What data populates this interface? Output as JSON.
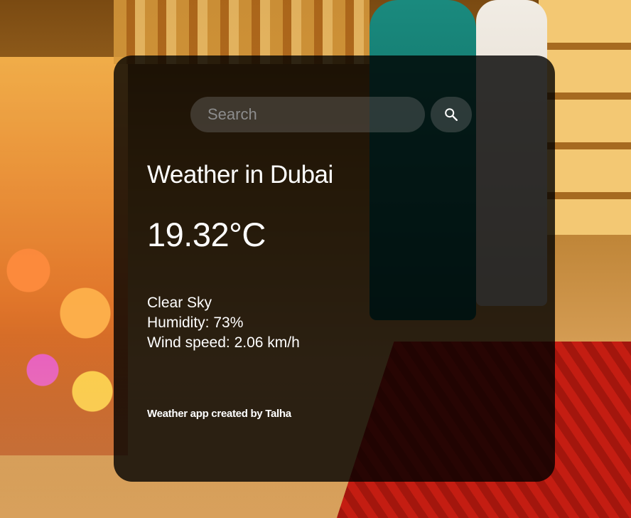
{
  "search": {
    "placeholder": "Search",
    "button_icon": "search-icon"
  },
  "weather": {
    "city_title": "Weather in Dubai",
    "temperature": "19.32°C",
    "description": "Clear Sky",
    "humidity": "Humidity: 73%",
    "wind": "Wind speed: 2.06 km/h"
  },
  "footer": {
    "credit": "Weather app created by Talha"
  },
  "colors": {
    "card_background": "#000000",
    "text": "#ffffff",
    "search_background": "#7c7c7c"
  }
}
